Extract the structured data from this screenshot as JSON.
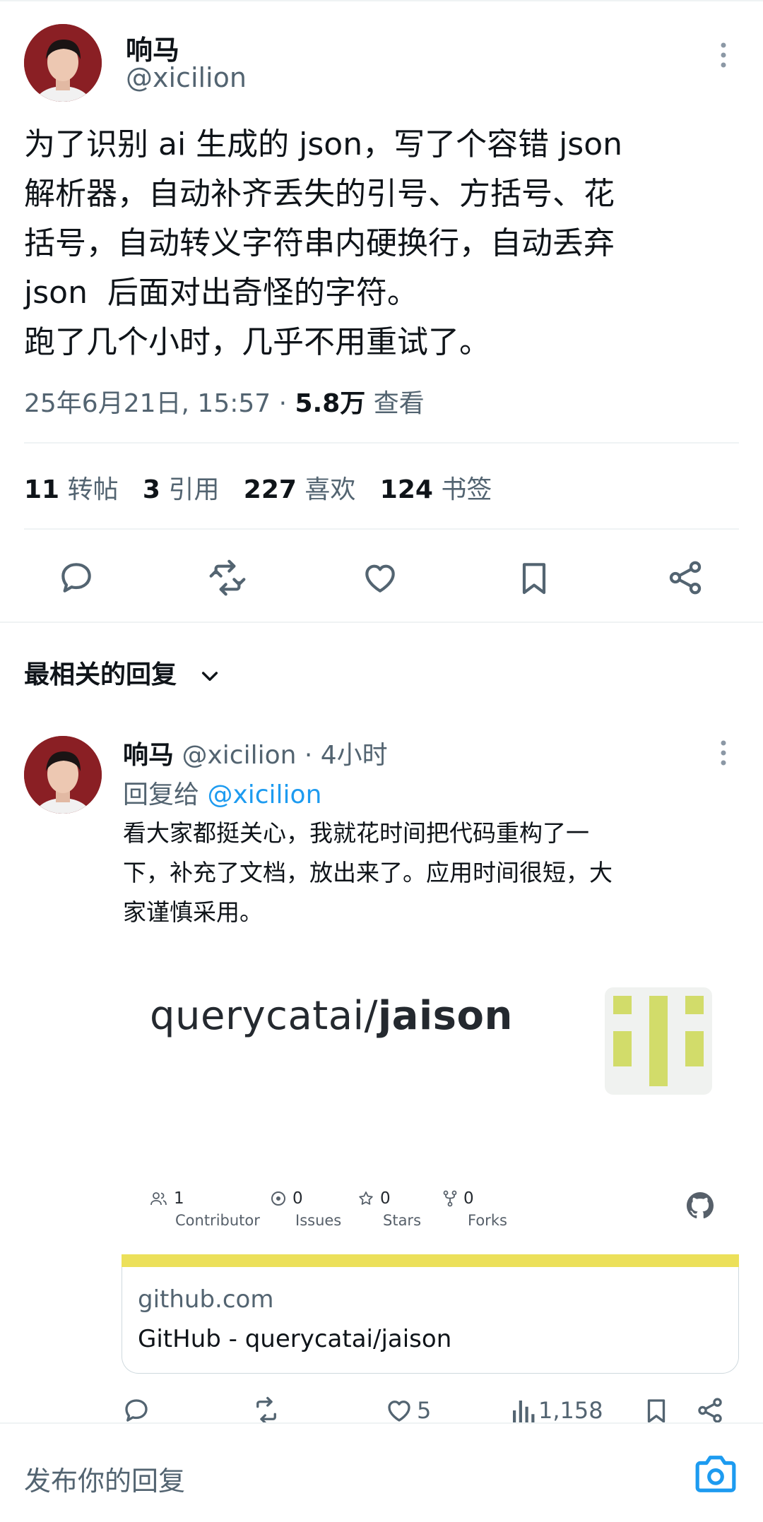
{
  "main_tweet": {
    "author_name": "响马",
    "author_handle": "@xicilion",
    "text_lines": [
      "为了识别 ai 生成的 json，写了个容错 json",
      "解析器，自动补齐丢失的引号、方括号、花",
      "括号，自动转义字符串内硬换行，自动丢弃",
      "json  后面对出奇怪的字符。",
      "跑了几个小时，几乎不用重试了。"
    ],
    "timestamp": "25年6月21日, 15:57 · ",
    "views_count": "5.8万",
    "views_label": " 查看",
    "stats": {
      "retweets_count": "11",
      "retweets_label": "转帖",
      "quotes_count": "3",
      "quotes_label": "引用",
      "likes_count": "227",
      "likes_label": "喜欢",
      "bookmarks_count": "124",
      "bookmarks_label": "书签"
    }
  },
  "replies_sort": {
    "label": "最相关的回复"
  },
  "reply": {
    "author_name": "响马",
    "meta": "@xicilion · 4小时",
    "reply_to_prefix": "回复给 ",
    "reply_to_handle": "@xicilion",
    "text_lines": [
      "看大家都挺关心，我就花时间把代码重构了一",
      "下，补充了文档，放出来了。应用时间很短，大",
      "家谨慎采用。"
    ],
    "card": {
      "repo_owner": "querycatai/",
      "repo_name": "jaison",
      "stats": [
        {
          "value": "1",
          "label": "Contributor",
          "icon": "people-icon"
        },
        {
          "value": "0",
          "label": "Issues",
          "icon": "issue-icon"
        },
        {
          "value": "0",
          "label": "Stars",
          "icon": "star-icon"
        },
        {
          "value": "0",
          "label": "Forks",
          "icon": "fork-icon"
        }
      ],
      "domain": "github.com",
      "title": "GitHub - querycatai/jaison"
    },
    "actions": {
      "likes": "5",
      "views": "1,158"
    }
  },
  "compose": {
    "placeholder": "发布你的回复"
  },
  "colors": {
    "text": "#0f1419",
    "muted": "#536471",
    "link": "#1d9bf0",
    "card_bar": "#ece05a",
    "logo_green": "#d2dc6a"
  }
}
